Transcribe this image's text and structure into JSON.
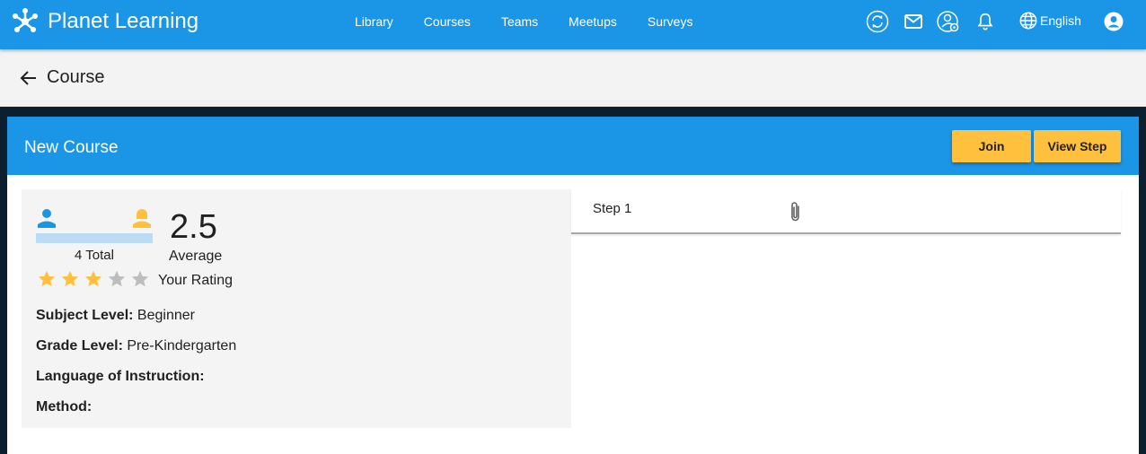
{
  "app": {
    "name": "Planet Learning"
  },
  "nav": {
    "items": [
      "Library",
      "Courses",
      "Teams",
      "Meetups",
      "Surveys"
    ]
  },
  "toolbar": {
    "icons": [
      "sync-icon",
      "mail-icon",
      "user-settings-icon",
      "bell-icon",
      "globe-icon",
      "account-icon"
    ],
    "language": "English"
  },
  "page": {
    "title": "Course"
  },
  "course": {
    "title": "New Course",
    "join_label": "Join",
    "view_step_label": "View Step"
  },
  "rating": {
    "total": "4 Total",
    "average": "2.5",
    "average_label": "Average",
    "your_rating_label": "Your Rating",
    "stars_filled": 3,
    "stars_max": 5
  },
  "meta": [
    {
      "label": "Subject Level:",
      "value": " Beginner"
    },
    {
      "label": "Grade Level:",
      "value": " Pre-Kindergarten"
    },
    {
      "label": "Language of Instruction:",
      "value": ""
    },
    {
      "label": "Method:",
      "value": ""
    }
  ],
  "steps": [
    {
      "label": "Step 1",
      "has_attachment": true
    }
  ],
  "colors": {
    "primary": "#1b95e6",
    "accent": "#ffc13d",
    "male": "#1b95e6",
    "female": "#ffc13d"
  }
}
